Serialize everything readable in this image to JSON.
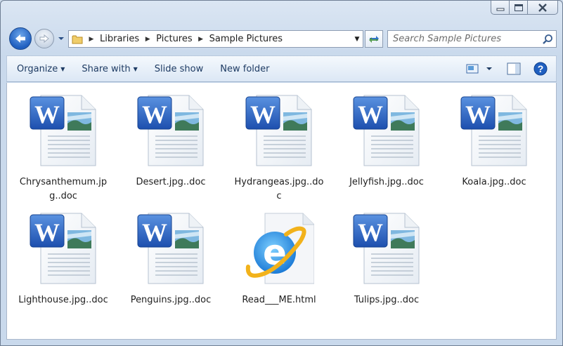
{
  "window": {
    "caption_buttons": [
      "minimize-icon",
      "maximize-icon",
      "close-icon"
    ]
  },
  "address_bar": {
    "breadcrumbs": [
      "Libraries",
      "Pictures",
      "Sample Pictures"
    ]
  },
  "search": {
    "placeholder": "Search Sample Pictures"
  },
  "toolbar": {
    "organize_label": "Organize",
    "share_label": "Share with",
    "slideshow_label": "Slide show",
    "new_folder_label": "New folder"
  },
  "files": [
    {
      "name": "Chrysanthemum.jpg..doc",
      "type": "word-doc-icon"
    },
    {
      "name": "Desert.jpg..doc",
      "type": "word-doc-icon"
    },
    {
      "name": "Hydrangeas.jpg..doc",
      "type": "word-doc-icon"
    },
    {
      "name": "Jellyfish.jpg..doc",
      "type": "word-doc-icon"
    },
    {
      "name": "Koala.jpg..doc",
      "type": "word-doc-icon"
    },
    {
      "name": "Lighthouse.jpg..doc",
      "type": "word-doc-icon"
    },
    {
      "name": "Penguins.jpg..doc",
      "type": "word-doc-icon"
    },
    {
      "name": "Read___ME.html",
      "type": "ie-html-icon"
    },
    {
      "name": "Tulips.jpg..doc",
      "type": "word-doc-icon"
    }
  ],
  "colors": {
    "word_blue": "#2a63c4",
    "ie_blue": "#2f8fe0",
    "ie_gold": "#f2b21b"
  }
}
